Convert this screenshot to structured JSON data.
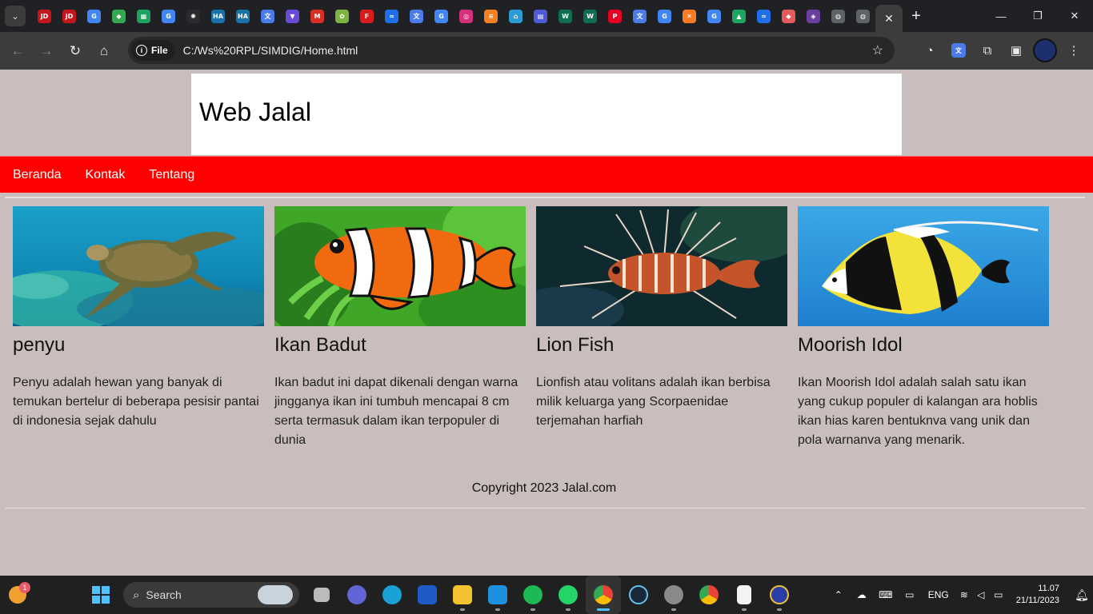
{
  "browser": {
    "url_scheme_label": "File",
    "url": "C:/Ws%20RPL/SIMDIG/Home.html",
    "tab_favicons": [
      {
        "name": "jd-icon",
        "color": "#c4161c",
        "text": "JD"
      },
      {
        "name": "jd-icon",
        "color": "#c4161c",
        "text": "JD"
      },
      {
        "name": "google-icon",
        "color": "#4285f4",
        "text": "G"
      },
      {
        "name": "maps-icon",
        "color": "#34a853",
        "text": "◆"
      },
      {
        "name": "sheets-icon",
        "color": "#1ea362",
        "text": "▦"
      },
      {
        "name": "google-icon",
        "color": "#4285f4",
        "text": "G"
      },
      {
        "name": "ai-icon",
        "color": "#2b2b2b",
        "text": "✺"
      },
      {
        "name": "ha-icon",
        "color": "#1a73a8",
        "text": "HA"
      },
      {
        "name": "ha-icon",
        "color": "#1a73a8",
        "text": "HA"
      },
      {
        "name": "translate-icon",
        "color": "#4a7be8",
        "text": "文"
      },
      {
        "name": "vpn-icon",
        "color": "#6a4bd8",
        "text": "▼"
      },
      {
        "name": "gmail-icon",
        "color": "#d93025",
        "text": "M"
      },
      {
        "name": "app-icon",
        "color": "#7cb342",
        "text": "✿"
      },
      {
        "name": "flash-icon",
        "color": "#d81b1b",
        "text": "F"
      },
      {
        "name": "messenger-icon",
        "color": "#1e6fe8",
        "text": "≈"
      },
      {
        "name": "translate-icon",
        "color": "#4a7be8",
        "text": "文"
      },
      {
        "name": "google-icon",
        "color": "#4285f4",
        "text": "G"
      },
      {
        "name": "instagram-icon",
        "color": "#d6307d",
        "text": "◎"
      },
      {
        "name": "stackoverflow-icon",
        "color": "#f48024",
        "text": "≡"
      },
      {
        "name": "home-icon",
        "color": "#2d9bd6",
        "text": "⌂"
      },
      {
        "name": "app-icon",
        "color": "#4e5bd6",
        "text": "▤"
      },
      {
        "name": "w-icon",
        "color": "#0f6e4f",
        "text": "W"
      },
      {
        "name": "w-icon",
        "color": "#0f6e4f",
        "text": "W"
      },
      {
        "name": "pinterest-icon",
        "color": "#e60023",
        "text": "P"
      },
      {
        "name": "translate-icon",
        "color": "#4a7be8",
        "text": "文"
      },
      {
        "name": "google-icon",
        "color": "#4285f4",
        "text": "G"
      },
      {
        "name": "xampp-icon",
        "color": "#fb7a24",
        "text": "✕"
      },
      {
        "name": "google-icon",
        "color": "#4285f4",
        "text": "G"
      },
      {
        "name": "drive-icon",
        "color": "#1fa463",
        "text": "▲"
      },
      {
        "name": "messenger-icon",
        "color": "#1e6fe8",
        "text": "≈"
      },
      {
        "name": "app-icon",
        "color": "#e55a5a",
        "text": "◆"
      },
      {
        "name": "app-icon",
        "color": "#6b3fa0",
        "text": "◈"
      },
      {
        "name": "globe-icon",
        "color": "#5f6368",
        "text": "◍"
      },
      {
        "name": "globe-icon",
        "color": "#5f6368",
        "text": "◍"
      }
    ]
  },
  "site": {
    "title": "Web Jalal",
    "nav": [
      "Beranda",
      "Kontak",
      "Tentang"
    ],
    "footer": "Copyright 2023 Jalal.com"
  },
  "cards": [
    {
      "title": "penyu",
      "text": "Penyu adalah hewan yang banyak di temukan bertelur di beberapa pesisir pantai di indonesia sejak dahulu"
    },
    {
      "title": "Ikan Badut",
      "text": "Ikan badut ini dapat dikenali dengan warna jingganya ikan ini tumbuh mencapai 8 cm serta termasuk dalam ikan terpopuler di dunia"
    },
    {
      "title": "Lion Fish",
      "text": "Lionfish atau volitans adalah ikan berbisa milik keluarga yang Scorpaenidae terjemahan harfiah"
    },
    {
      "title": "Moorish Idol",
      "text": "Ikan Moorish Idol adalah salah satu ikan yang cukup populer di kalangan ara hoblis ikan hias karen bentuknva vang unik dan pola warnanva yang menarik."
    }
  ],
  "taskbar": {
    "search_placeholder": "Search",
    "notification_count": "1",
    "language": "ENG",
    "time": "11.07",
    "date": "21/11/2023"
  }
}
